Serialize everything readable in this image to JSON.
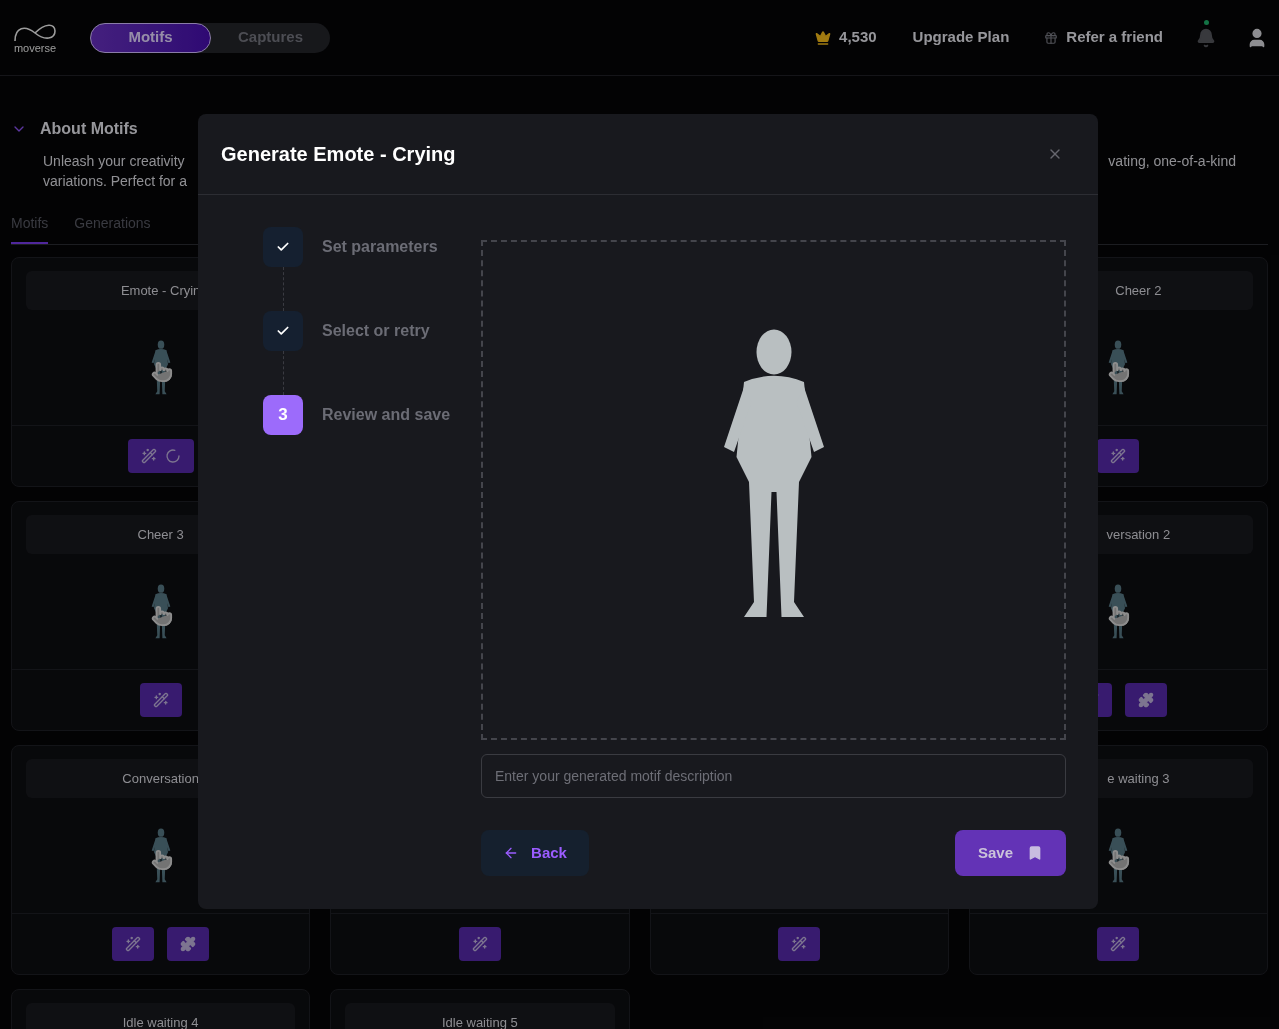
{
  "header": {
    "logo_text": "moverse",
    "mode_tabs": [
      {
        "label": "Motifs",
        "selected": true
      },
      {
        "label": "Captures",
        "selected": false
      }
    ],
    "credits": "4,530",
    "upgrade": "Upgrade Plan",
    "refer": "Refer a friend",
    "notification_dot": true
  },
  "about": {
    "title": "About Motifs",
    "expanded": true,
    "text_left": [
      "Unleash your creativity",
      "variations. Perfect for a"
    ],
    "text_right": "vating, one-of-a-kind"
  },
  "tabs": [
    {
      "label": "Motifs",
      "selected": true
    },
    {
      "label": "Generations",
      "selected": false
    }
  ],
  "card_rows": [
    {
      "left": [
        {
          "title": "Emote - Cryin",
          "buttons": [
            {
              "kind": "generating"
            }
          ]
        }
      ],
      "right": [
        {
          "title": "Cheer 2",
          "buttons": [
            {
              "kind": "generate"
            }
          ]
        }
      ]
    },
    {
      "left": [
        {
          "title": "Cheer 3",
          "buttons": [
            {
              "kind": "generate"
            }
          ]
        }
      ],
      "right": [
        {
          "title": "versation 2",
          "buttons": [
            {
              "kind": "generate"
            },
            {
              "kind": "extend"
            }
          ]
        }
      ]
    },
    {
      "left": [
        {
          "title": "Conversation",
          "buttons": [
            {
              "kind": "generate"
            },
            {
              "kind": "extend"
            }
          ]
        },
        {
          "buttons": [
            {
              "kind": "generate"
            }
          ]
        },
        {
          "buttons": [
            {
              "kind": "generate"
            }
          ]
        }
      ],
      "right": [
        {
          "title": "e waiting 3",
          "buttons": [
            {
              "kind": "generate"
            }
          ]
        }
      ]
    },
    {
      "left": [
        {
          "title": "Idle waiting 4"
        },
        {
          "title": "Idle waiting 5"
        }
      ]
    }
  ],
  "modal": {
    "title": "Generate Emote - Crying",
    "steps": [
      {
        "label": "Set parameters",
        "done": true
      },
      {
        "label": "Select or retry",
        "done": true
      },
      {
        "label": "Review and save",
        "done": false,
        "number": "3"
      }
    ],
    "description_placeholder": "Enter your generated motif description",
    "back": "Back",
    "save": "Save"
  }
}
